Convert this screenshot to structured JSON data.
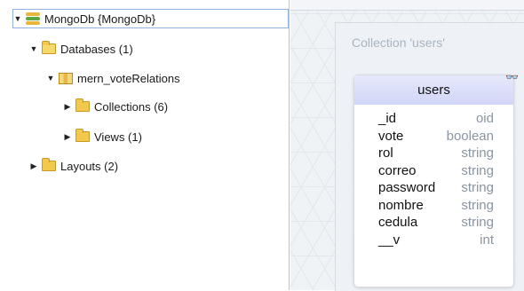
{
  "tree": {
    "root": {
      "label": "MongoDb {MongoDb}",
      "expanded": true,
      "selected": true,
      "icon": "mongodb-icon"
    },
    "databases": {
      "label": "Databases (1)",
      "expanded": true,
      "icon": "folder-open-icon"
    },
    "database": {
      "label": "mern_voteRelations",
      "expanded": true,
      "icon": "database-map-icon"
    },
    "collections": {
      "label": "Collections (6)",
      "expanded": false,
      "icon": "folder-icon"
    },
    "views": {
      "label": "Views (1)",
      "expanded": false,
      "icon": "folder-icon"
    },
    "layouts": {
      "label": "Layouts (2)",
      "expanded": false,
      "icon": "folder-icon"
    }
  },
  "canvas": {
    "collection_title": "Collection 'users'",
    "card": {
      "title": "users",
      "fields": [
        {
          "name": "_id",
          "type": "oid"
        },
        {
          "name": "vote",
          "type": "boolean"
        },
        {
          "name": "rol",
          "type": "string"
        },
        {
          "name": "correo",
          "type": "string"
        },
        {
          "name": "password",
          "type": "string"
        },
        {
          "name": "nombre",
          "type": "string"
        },
        {
          "name": "cedula",
          "type": "string"
        },
        {
          "name": "__v",
          "type": "int"
        }
      ]
    }
  },
  "colors": {
    "card_header": "#d2d6f7",
    "type_text": "#8a95a3",
    "folder": "#f2c94c",
    "selection_border": "#8fb3d9"
  }
}
